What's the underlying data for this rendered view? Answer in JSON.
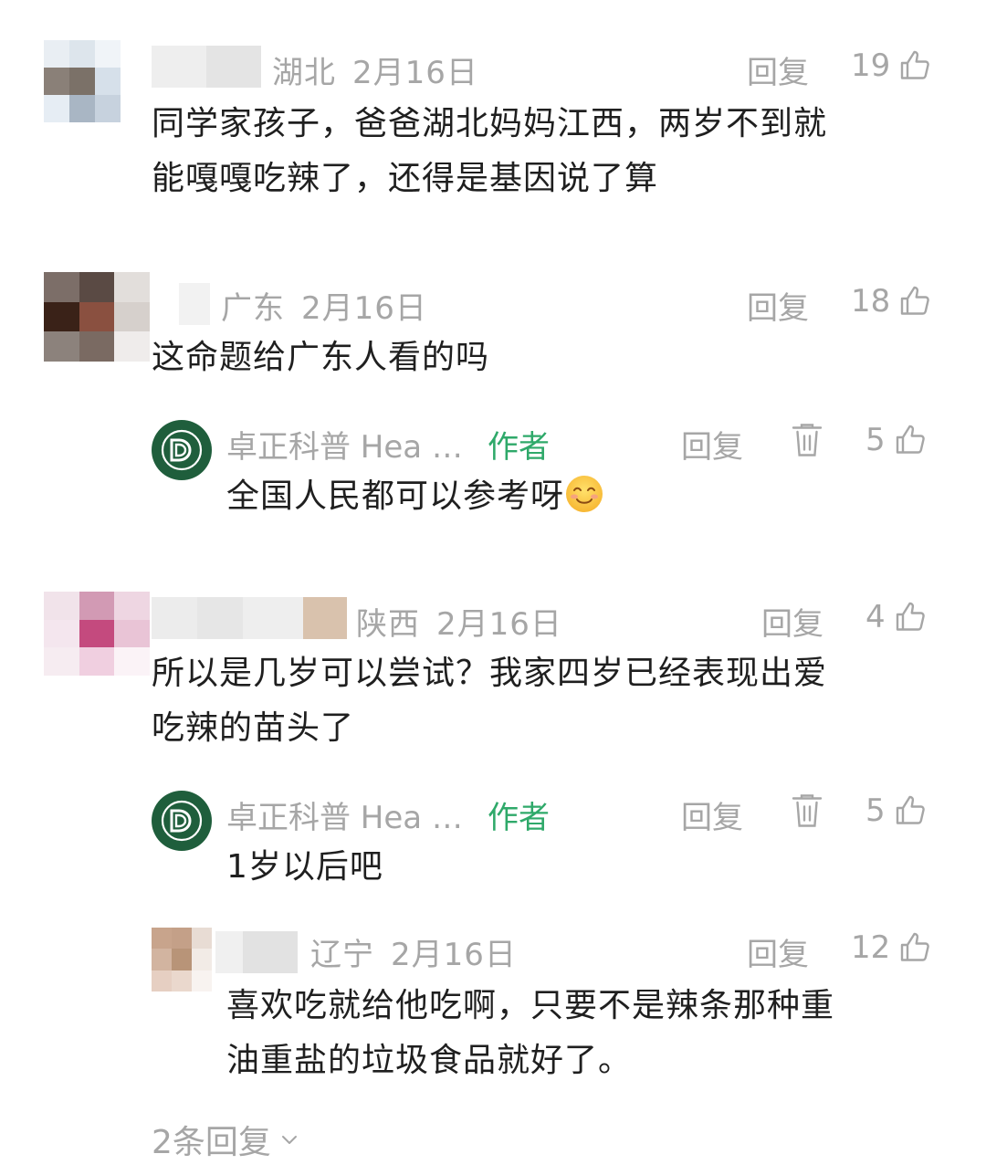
{
  "comments": [
    {
      "region": "湖北",
      "date": "2月16日",
      "reply_label": "回复",
      "likes": "19",
      "text_lines": [
        "同学家孩子，爸爸湖北妈妈江西，两岁不到就",
        "能嘎嘎吃辣了，还得是基因说了算"
      ]
    },
    {
      "region": "广东",
      "date": "2月16日",
      "reply_label": "回复",
      "likes": "18",
      "text_lines": [
        "这命题给广东人看的吗"
      ]
    },
    {
      "region": "陕西",
      "date": "2月16日",
      "reply_label": "回复",
      "likes": "4",
      "text_lines": [
        "所以是几岁可以尝试？我家四岁已经表现出爱",
        "吃辣的苗头了"
      ]
    }
  ],
  "author_replies": [
    {
      "name": "卓正科普 Hea …",
      "tag": "作者",
      "reply_label": "回复",
      "likes": "5",
      "text": "全国人民都可以参考呀"
    },
    {
      "name": "卓正科普 Hea …",
      "tag": "作者",
      "reply_label": "回复",
      "likes": "5",
      "text": "1岁以后吧"
    }
  ],
  "sub_reply": {
    "region": "辽宁",
    "date": "2月16日",
    "reply_label": "回复",
    "likes": "12",
    "text_lines": [
      "喜欢吃就给他吃啊，只要不是辣条那种重",
      "油重盐的垃圾食品就好了。"
    ]
  },
  "more_replies": "2条回复",
  "icons": {
    "like": "thumbs-up-icon",
    "delete": "trash-icon",
    "expand": "chevron-down-icon",
    "emoji": "smiling-face-emoji-icon",
    "author_logo": "zhuozheng-logo-icon"
  },
  "colors": {
    "meta_text": "#a6a6a6",
    "body_text": "#1f1f1f",
    "author_tag": "#2fa96a",
    "logo_bg": "#1f5e3c"
  }
}
